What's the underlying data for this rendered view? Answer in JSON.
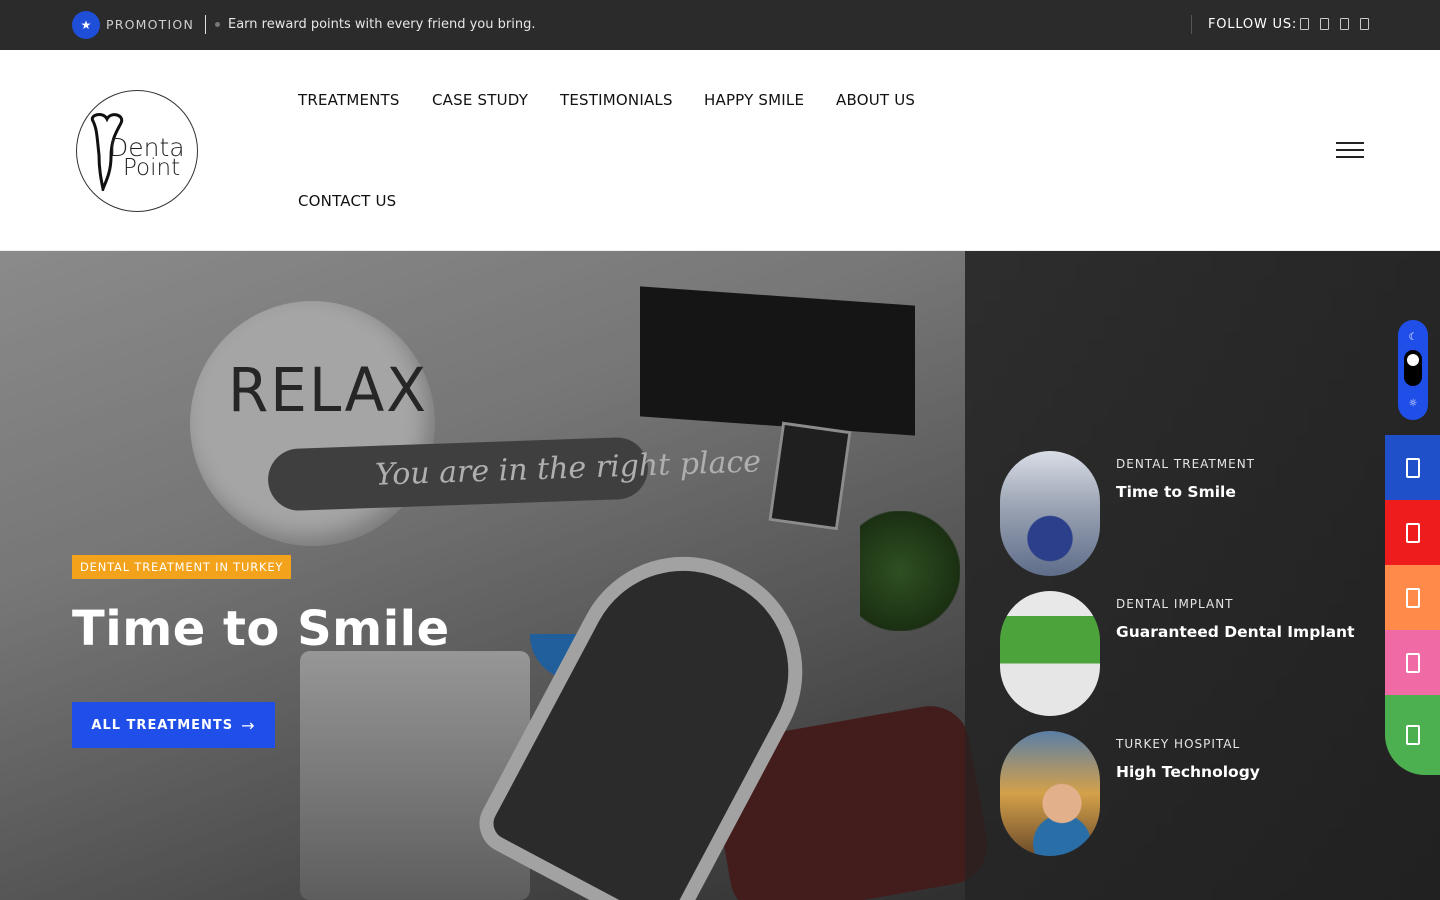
{
  "topbar": {
    "promo_label": "PROMOTION",
    "promo_text": "Earn reward points with every friend you bring.",
    "follow_label": "FOLLOW US:",
    "social_icons": [
      "facebook-icon",
      "instagram-icon",
      "youtube-icon",
      "twitter-icon"
    ]
  },
  "header": {
    "logo_line1": "Denta",
    "logo_line2": "Point",
    "nav": [
      "TREATMENTS",
      "CASE STUDY",
      "TESTIMONIALS",
      "HAPPY SMILE",
      "ABOUT US",
      "CONTACT US"
    ]
  },
  "hero": {
    "badge": "DENTAL TREATMENT IN TURKEY",
    "title": "Time to Smile",
    "button": "ALL TREATMENTS",
    "button_icon": "arrow-right-icon",
    "scene_relax": "RELAX",
    "scene_banner": "You are in the right place"
  },
  "slides": [
    {
      "kicker": "DENTAL TREATMENT",
      "title": "Time to Smile"
    },
    {
      "kicker": "DENTAL IMPLANT",
      "title": "Guaranteed Dental Implant"
    },
    {
      "kicker": "TURKEY HOSPITAL",
      "title": "High Technology"
    }
  ],
  "side_buttons": [
    {
      "icon": "phone-icon",
      "color": "#1f4fc9"
    },
    {
      "icon": "youtube-icon",
      "color": "#ee1c1c"
    },
    {
      "icon": "calendar-icon",
      "color": "#ff8a4a"
    },
    {
      "icon": "instagram-icon",
      "color": "#f06aa6"
    },
    {
      "icon": "whatsapp-icon",
      "color": "#4caf50"
    }
  ],
  "colors": {
    "accent_blue": "#1f4fe8",
    "badge_orange": "#f2a21b",
    "topbar_bg": "#2b2b2b"
  }
}
